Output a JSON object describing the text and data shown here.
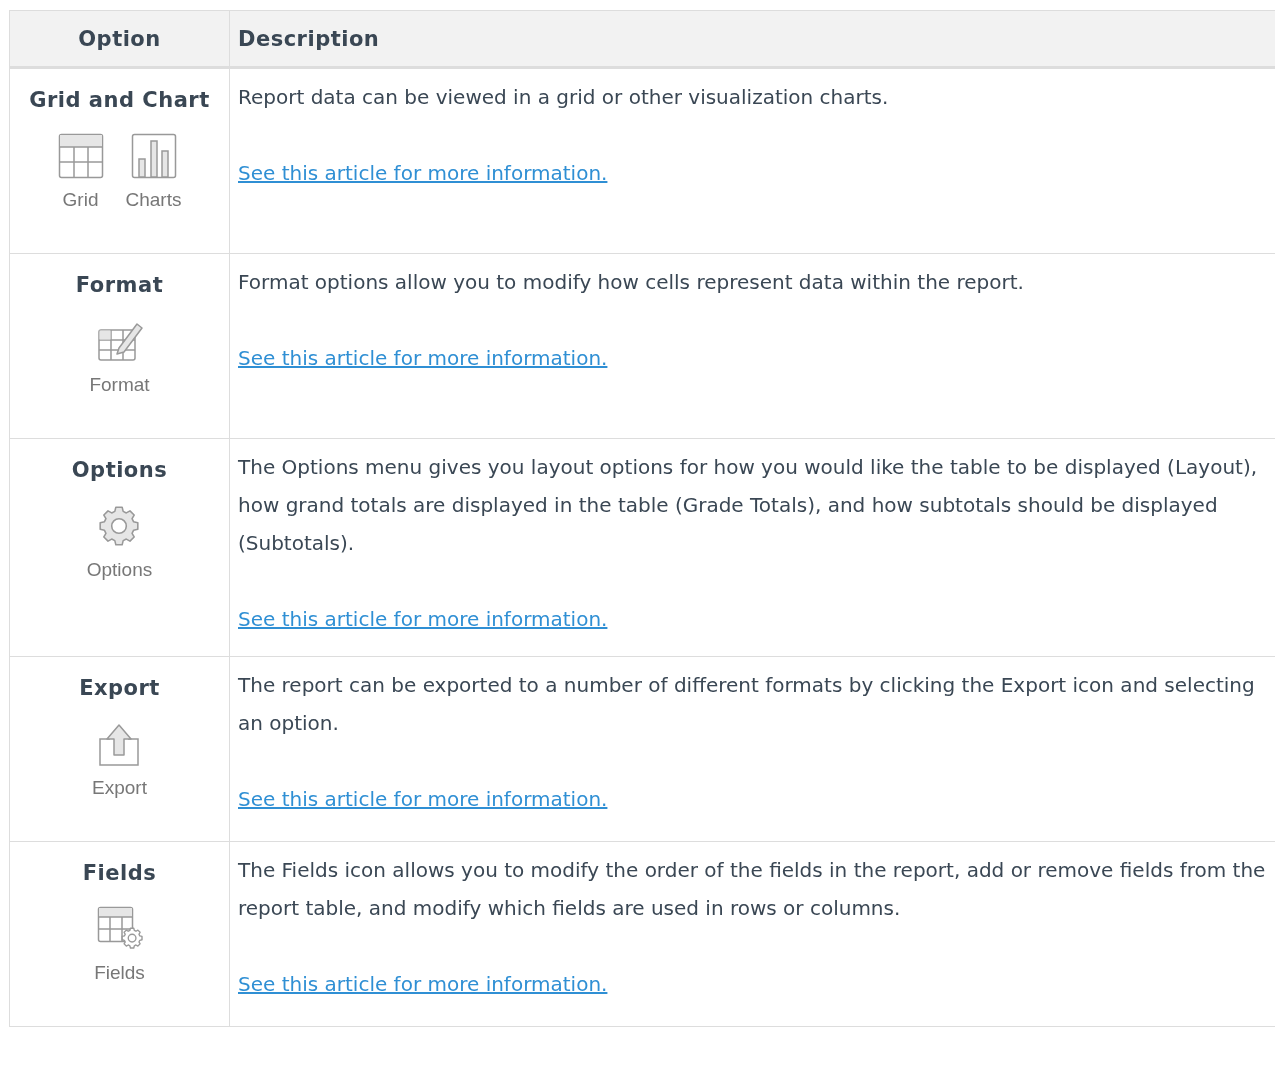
{
  "table": {
    "columns": [
      "Option",
      "Description"
    ],
    "rows": [
      {
        "title": "Grid and Chart",
        "icons": [
          {
            "kind": "grid",
            "label": "Grid"
          },
          {
            "kind": "chart",
            "label": "Charts"
          }
        ],
        "paragraphs": [
          "Report data can be viewed in a grid or other visualization charts."
        ],
        "link": "See this article for more information."
      },
      {
        "title": "Format",
        "icons": [
          {
            "kind": "format",
            "label": "Format"
          }
        ],
        "paragraphs": [
          "Format options allow you to modify how cells represent data within the report."
        ],
        "link": "See this article for more information."
      },
      {
        "title": "Options",
        "icons": [
          {
            "kind": "gear",
            "label": "Options"
          }
        ],
        "paragraphs": [
          "The Options menu gives you layout options for how you would like the table to be displayed (Layout), how grand totals are displayed in the table (Grade Totals), and how subtotals should be displayed (Subtotals)."
        ],
        "link": "See this article for more information."
      },
      {
        "title": "Export",
        "icons": [
          {
            "kind": "export",
            "label": "Export"
          }
        ],
        "paragraphs": [
          "The report can be exported to a number of different formats by clicking the Export icon and selecting an option."
        ],
        "link": "See this article for more information."
      },
      {
        "title": "Fields",
        "icons": [
          {
            "kind": "fields",
            "label": "Fields"
          }
        ],
        "paragraphs": [
          "The Fields icon allows you to modify the order of the fields in the report, add or remove fields from the report table, and modify which fields are used in rows or columns."
        ],
        "link": "See this article for more information."
      }
    ]
  }
}
